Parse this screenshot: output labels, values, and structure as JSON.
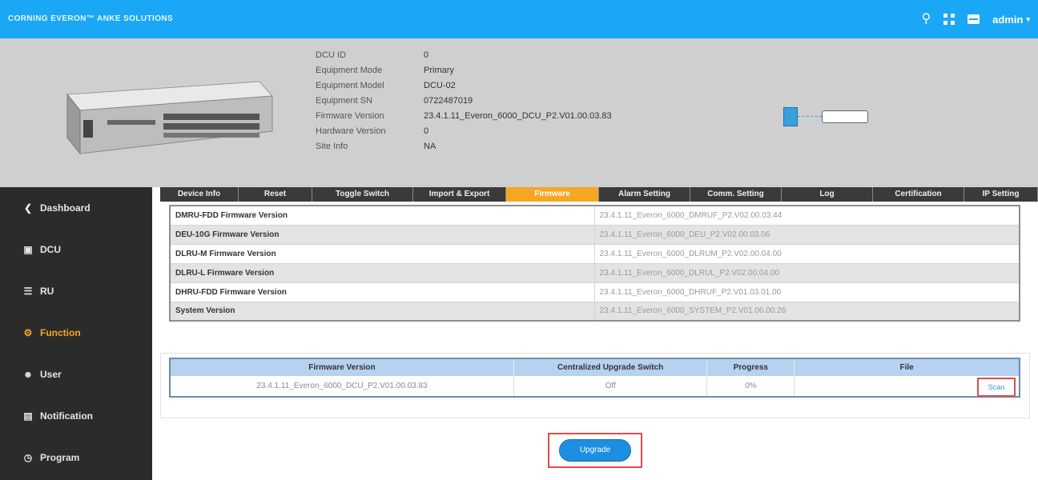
{
  "app": {
    "brand": "CORNING EVERON™ ANKE SOLUTIONS",
    "user": "admin"
  },
  "device_info": [
    {
      "key": "DCU ID",
      "value": "0"
    },
    {
      "key": "Equipment Mode",
      "value": "Primary"
    },
    {
      "key": "Equipment Model",
      "value": "DCU-02"
    },
    {
      "key": "Equipment SN",
      "value": "0722487019"
    },
    {
      "key": "Firmware Version",
      "value": "23.4.1.11_Everon_6000_DCU_P2.V01.00.03.83"
    },
    {
      "key": "Hardware Version",
      "value": "0"
    },
    {
      "key": "Site Info",
      "value": "NA"
    }
  ],
  "sidebar": {
    "items": [
      {
        "label": "Dashboard"
      },
      {
        "label": "DCU"
      },
      {
        "label": "RU"
      },
      {
        "label": "Function"
      },
      {
        "label": "User"
      },
      {
        "label": "Notification"
      },
      {
        "label": "Program"
      }
    ]
  },
  "tabs": [
    {
      "label": "Device Info"
    },
    {
      "label": "Reset"
    },
    {
      "label": "Toggle Switch"
    },
    {
      "label": "Import & Export"
    },
    {
      "label": "Firmware"
    },
    {
      "label": "Alarm Setting"
    },
    {
      "label": "Comm. Setting"
    },
    {
      "label": "Log"
    },
    {
      "label": "Certification"
    },
    {
      "label": "IP Setting"
    }
  ],
  "versions": [
    {
      "name": "DMRU-FDD Firmware Version",
      "value": "23.4.1.11_Everon_6000_DMRUF_P2.V02.00.03.44"
    },
    {
      "name": "DEU-10G Firmware Version",
      "value": "23.4.1.11_Everon_6000_DEU_P2.V02.00.03.06"
    },
    {
      "name": "DLRU-M Firmware Version",
      "value": "23.4.1.11_Everon_6000_DLRUM_P2.V02.00.04.00"
    },
    {
      "name": "DLRU-L Firmware Version",
      "value": "23.4.1.11_Everon_6000_DLRUL_P2.V02.00.04.00"
    },
    {
      "name": "DHRU-FDD Firmware Version",
      "value": "23.4.1.11_Everon_6000_DHRUF_P2.V01.03.01.00"
    },
    {
      "name": "System Version",
      "value": "23.4.1.11_Everon_6000_SYSTEM_P2.V01.06.00.26"
    }
  ],
  "upgrade_table": {
    "headers": [
      "Firmware Version",
      "Centralized Upgrade Switch",
      "Progress",
      "File"
    ],
    "row": {
      "firmware": "23.4.1.11_Everon_6000_DCU_P2.V01.00.03.83",
      "switch": "Off",
      "progress": "0%",
      "scan_label": "Scan"
    }
  },
  "upgrade_button": "Upgrade",
  "colors": {
    "topbar": "#1aa7f5",
    "active_tab": "#f5a623",
    "active_menu": "#f5a623",
    "button": "#1c8fe0",
    "highlight": "#e34a4a"
  }
}
